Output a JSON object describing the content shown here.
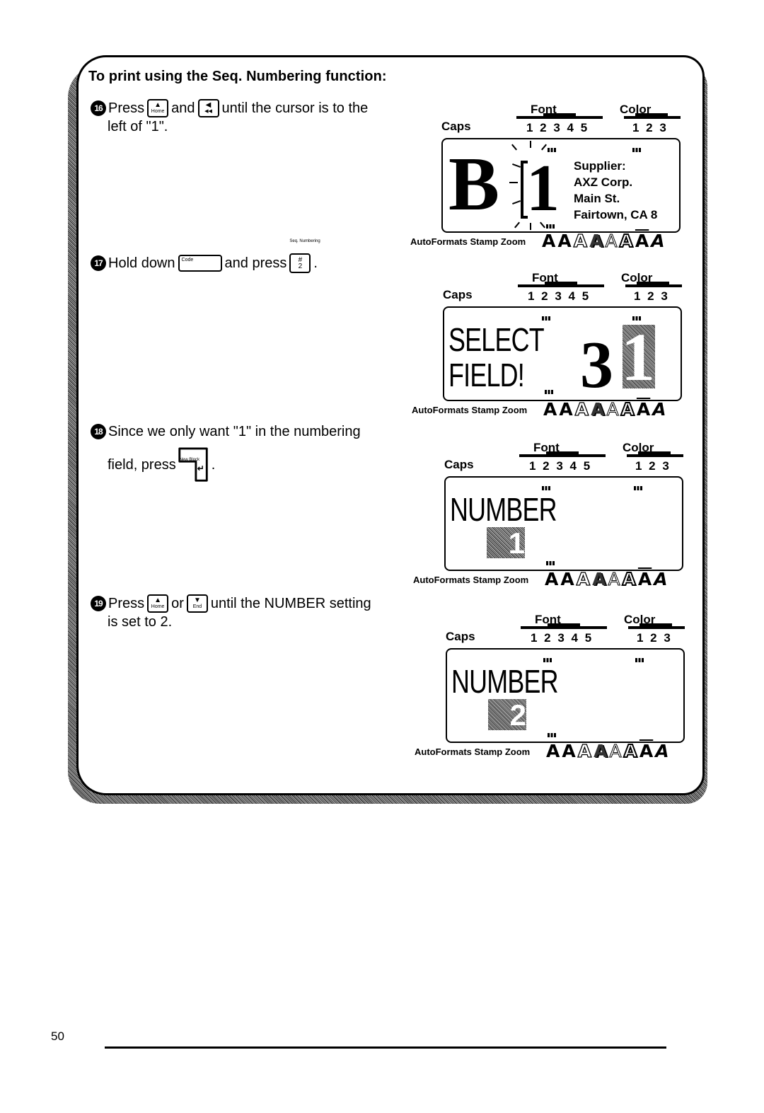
{
  "section": {
    "title": "To print using the Seq. Numbering function:"
  },
  "steps": [
    {
      "number": "16",
      "parts": [
        "Press",
        "and",
        "until the cursor is to the"
      ],
      "continuation": "left of \"1\".",
      "keys": [
        {
          "glyph": "▲",
          "label": "Home"
        },
        {
          "glyph": "◀",
          "label": "◀◀"
        }
      ]
    },
    {
      "number": "17",
      "parts": [
        "Hold down",
        "and press",
        "."
      ],
      "keys": [
        {
          "label": "Code"
        },
        {
          "glyph": "#",
          "label": "2",
          "above": "Seq. Numbering"
        }
      ]
    },
    {
      "number": "18",
      "parts": [
        "Since we only want \"1\" in the numbering"
      ],
      "continuation": "field, press",
      "end": ".",
      "keys": [
        {
          "glyph": "↵",
          "label": "New Block"
        }
      ]
    },
    {
      "number": "19",
      "parts": [
        "Press",
        "or",
        "until the NUMBER setting"
      ],
      "continuation": "is set to 2.",
      "keys": [
        {
          "glyph": "▲",
          "label": "Home"
        },
        {
          "glyph": "▼",
          "label": "End"
        }
      ]
    }
  ],
  "display_common": {
    "caps": "Caps",
    "font": "Font",
    "font_nums": "1 2 3 4 5",
    "color": "Color",
    "color_nums": "1 2 3",
    "autoformats": "AutoFormats Stamp Zoom",
    "glyphs": [
      "A",
      "A",
      "A",
      "A",
      "A",
      "A",
      "A",
      "A"
    ]
  },
  "displays": [
    {
      "big_letter": "B",
      "cursor_char": "1",
      "address": [
        "Supplier:",
        "AXZ Corp.",
        "Main St.",
        "Fairtown, CA 8"
      ]
    },
    {
      "line1": "SELECT",
      "line2": "FIELD!",
      "digit": "3",
      "shaded_char": "1"
    },
    {
      "line1": "NUMBER",
      "shaded_char": "1"
    },
    {
      "line1": "NUMBER",
      "shaded_char": "2"
    }
  ],
  "footer": {
    "page_number": "50"
  }
}
